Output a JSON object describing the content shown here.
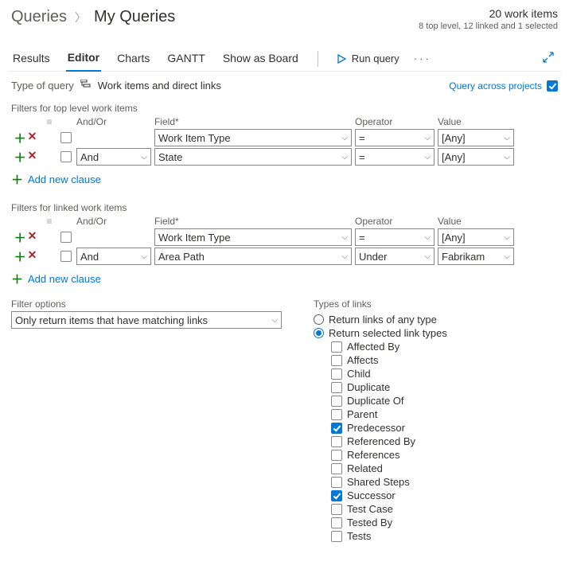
{
  "breadcrumb": {
    "parent": "Queries",
    "current": "My Queries"
  },
  "stats": {
    "count_line": "20 work items",
    "detail_line": "8 top level, 12 linked and 1 selected"
  },
  "tabs": {
    "results": "Results",
    "editor": "Editor",
    "charts": "Charts",
    "gantt": "GANTT",
    "board": "Show as Board",
    "run": "Run query"
  },
  "query_type": {
    "label": "Type of query",
    "value": "Work items and direct links",
    "across_label": "Query across projects"
  },
  "top_section_label": "Filters for top level work items",
  "linked_section_label": "Filters for linked work items",
  "headers": {
    "andor": "And/Or",
    "field": "Field*",
    "operator": "Operator",
    "value": "Value"
  },
  "top_rows": [
    {
      "andor": "",
      "field": "Work Item Type",
      "operator": "=",
      "value": "[Any]"
    },
    {
      "andor": "And",
      "field": "State",
      "operator": "=",
      "value": "[Any]"
    }
  ],
  "linked_rows": [
    {
      "andor": "",
      "field": "Work Item Type",
      "operator": "=",
      "value": "[Any]"
    },
    {
      "andor": "And",
      "field": "Area Path",
      "operator": "Under",
      "value": "Fabrikam"
    }
  ],
  "add_clause": "Add new clause",
  "filter_options": {
    "label": "Filter options",
    "value": "Only return items that have matching links"
  },
  "link_types": {
    "label": "Types of links",
    "mode_any": "Return links of any type",
    "mode_selected": "Return selected link types",
    "options": [
      {
        "label": "Affected By",
        "checked": false
      },
      {
        "label": "Affects",
        "checked": false
      },
      {
        "label": "Child",
        "checked": false
      },
      {
        "label": "Duplicate",
        "checked": false
      },
      {
        "label": "Duplicate Of",
        "checked": false
      },
      {
        "label": "Parent",
        "checked": false
      },
      {
        "label": "Predecessor",
        "checked": true
      },
      {
        "label": "Referenced By",
        "checked": false
      },
      {
        "label": "References",
        "checked": false
      },
      {
        "label": "Related",
        "checked": false
      },
      {
        "label": "Shared Steps",
        "checked": false
      },
      {
        "label": "Successor",
        "checked": true
      },
      {
        "label": "Test Case",
        "checked": false
      },
      {
        "label": "Tested By",
        "checked": false
      },
      {
        "label": "Tests",
        "checked": false
      }
    ]
  }
}
